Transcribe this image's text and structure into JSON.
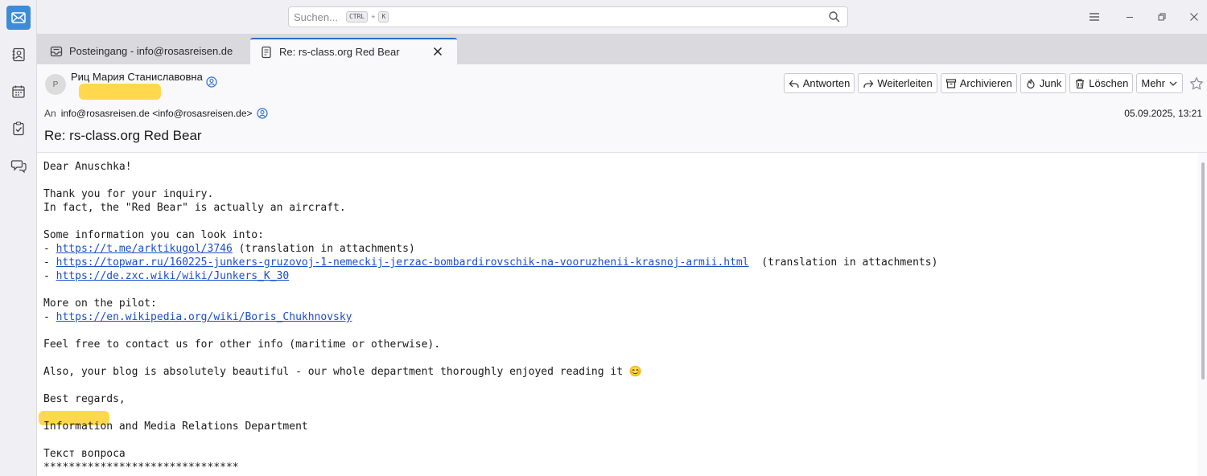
{
  "colors": {
    "accent": "#2b6cc9",
    "link": "#1a4fc9",
    "highlight": "#ffd43b"
  },
  "spaces": [
    {
      "name": "mail",
      "icon": "mail-icon"
    },
    {
      "name": "address-book",
      "icon": "address-book-icon"
    },
    {
      "name": "calendar",
      "icon": "calendar-icon"
    },
    {
      "name": "tasks",
      "icon": "tasks-icon"
    },
    {
      "name": "chat",
      "icon": "chat-icon"
    }
  ],
  "search": {
    "placeholder": "Suchen...",
    "key1": "CTRL",
    "plus": "+",
    "key2": "K"
  },
  "tabs": [
    {
      "label": "Posteingang - info@rosasreisen.de",
      "icon": "inbox-icon",
      "active": false
    },
    {
      "label": "Re: rs-class.org Red Bear",
      "icon": "message-icon",
      "active": true
    }
  ],
  "header": {
    "avatar_letter": "P",
    "sender": "Риц Мария Станиславовна",
    "to_label": "An",
    "to": "info@rosasreisen.de <info@rosasreisen.de>",
    "date": "05.09.2025, 13:21",
    "subject": "Re: rs-class.org Red Bear",
    "actions": {
      "reply": "Antworten",
      "forward": "Weiterleiten",
      "archive": "Archivieren",
      "junk": "Junk",
      "delete": "Löschen",
      "more": "Mehr"
    }
  },
  "body": {
    "greeting": "Dear Anuschka!",
    "line1": "Thank you for your inquiry.",
    "line2": "In fact, the \"Red Bear\" is actually an aircraft.",
    "info_intro": "Some information you can look into:",
    "link1": "https://t.me/arktikugol/3746",
    "link1_note": " (translation in attachments)",
    "link2": "https://topwar.ru/160225-junkers-gruzovoj-1-nemeckij-jerzac-bombardirovschik-na-vooruzhenii-krasnoj-armii.html",
    "link2_note": "  (translation in attachments)",
    "link3": "https://de.zxc.wiki/wiki/Junkers_K_30",
    "pilot_intro": "More on the pilot:",
    "link4": "https://en.wikipedia.org/wiki/Boris_Chukhnovsky",
    "contact": "Feel free to contact us for other info (maritime or otherwise).",
    "blog": "Also, your blog is absolutely beautiful - our whole department thoroughly enjoyed reading it",
    "emoji": "😊",
    "regards": "Best regards,",
    "department": "Information and Media Relations Department",
    "question_label": "Текст вопроса",
    "stars": "*******************************"
  }
}
